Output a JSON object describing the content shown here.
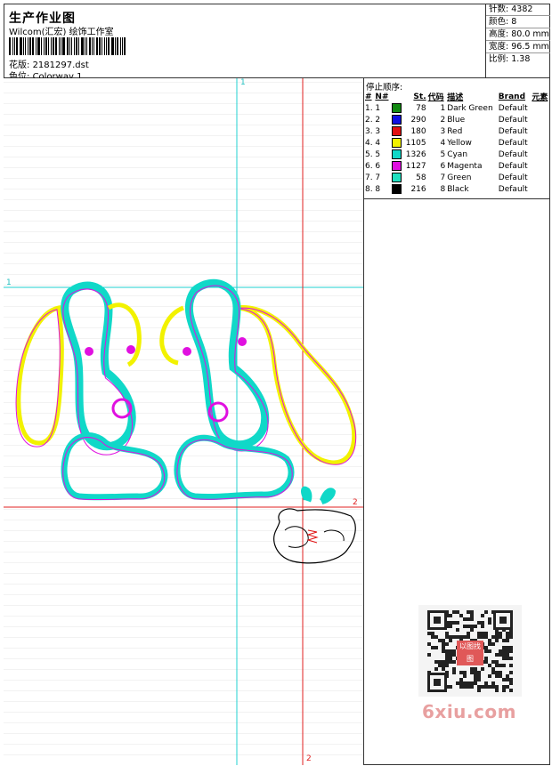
{
  "header": {
    "title": "生产作业图",
    "subtitle": "Wilcom(汇宏) 绘饰工作室",
    "design_label": "花版:",
    "design_value": "2181297.dst",
    "colorway_label": "色位:",
    "colorway_value": "Colorway 1"
  },
  "stats": {
    "stitches_label": "针数:",
    "stitches_value": "4382",
    "colors_label": "颜色:",
    "colors_value": "8",
    "height_label": "高度:",
    "height_value": "80.0 mm",
    "width_label": "宽度:",
    "width_value": "96.5 mm",
    "scale_label": "比例:",
    "scale_value": "1.38"
  },
  "sequence": {
    "title": "停止顺序:",
    "columns": [
      "#",
      "N#",
      "St.",
      "代码",
      "描述",
      "Brand",
      "元素"
    ],
    "rows": [
      {
        "n": "1.",
        "seq": "1",
        "color": "#128a12",
        "st": "78",
        "code": "1",
        "desc": "Dark Green",
        "brand": "Default"
      },
      {
        "n": "2.",
        "seq": "2",
        "color": "#1010e0",
        "st": "290",
        "code": "2",
        "desc": "Blue",
        "brand": "Default"
      },
      {
        "n": "3.",
        "seq": "3",
        "color": "#e01010",
        "st": "180",
        "code": "3",
        "desc": "Red",
        "brand": "Default"
      },
      {
        "n": "4.",
        "seq": "4",
        "color": "#f2f200",
        "st": "1105",
        "code": "4",
        "desc": "Yellow",
        "brand": "Default"
      },
      {
        "n": "5.",
        "seq": "5",
        "color": "#10d8c8",
        "st": "1326",
        "code": "5",
        "desc": "Cyan",
        "brand": "Default"
      },
      {
        "n": "6.",
        "seq": "6",
        "color": "#e010e0",
        "st": "1127",
        "code": "6",
        "desc": "Magenta",
        "brand": "Default"
      },
      {
        "n": "7.",
        "seq": "7",
        "color": "#20e0c0",
        "st": "58",
        "code": "7",
        "desc": "Green",
        "brand": "Default"
      },
      {
        "n": "8.",
        "seq": "8",
        "color": "#000000",
        "st": "216",
        "code": "8",
        "desc": "Black",
        "brand": "Default"
      }
    ]
  },
  "guides": {
    "v1": "1",
    "h1": "1",
    "h2": "2",
    "v2": "2"
  },
  "qr_mark": "以图找图",
  "watermark": "6xiu.com"
}
